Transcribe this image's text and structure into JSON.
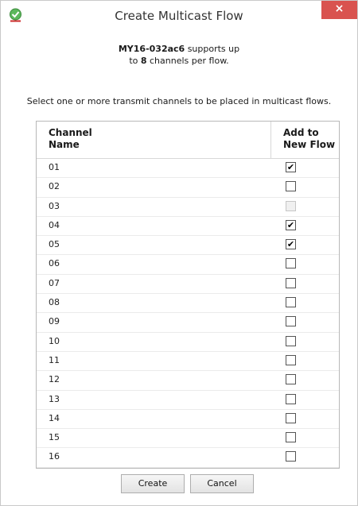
{
  "window": {
    "title": "Create Multicast Flow",
    "close_label": "×"
  },
  "intro": {
    "device_name": "MY16-032ac6",
    "supports_text": " supports up",
    "line2_prefix": "to ",
    "channel_count": "8",
    "line2_suffix": " channels per flow."
  },
  "instruction": "Select one or more transmit channels to be placed in multicast flows.",
  "table": {
    "header_name_line1": "Channel",
    "header_name_line2": "Name",
    "header_add_line1": "Add to",
    "header_add_line2": "New Flow",
    "rows": [
      {
        "name": "01",
        "checked": true,
        "disabled": false
      },
      {
        "name": "02",
        "checked": false,
        "disabled": false
      },
      {
        "name": "03",
        "checked": false,
        "disabled": true
      },
      {
        "name": "04",
        "checked": true,
        "disabled": false
      },
      {
        "name": "05",
        "checked": true,
        "disabled": false
      },
      {
        "name": "06",
        "checked": false,
        "disabled": false
      },
      {
        "name": "07",
        "checked": false,
        "disabled": false
      },
      {
        "name": "08",
        "checked": false,
        "disabled": false
      },
      {
        "name": "09",
        "checked": false,
        "disabled": false
      },
      {
        "name": "10",
        "checked": false,
        "disabled": false
      },
      {
        "name": "11",
        "checked": false,
        "disabled": false
      },
      {
        "name": "12",
        "checked": false,
        "disabled": false
      },
      {
        "name": "13",
        "checked": false,
        "disabled": false
      },
      {
        "name": "14",
        "checked": false,
        "disabled": false
      },
      {
        "name": "15",
        "checked": false,
        "disabled": false
      },
      {
        "name": "16",
        "checked": false,
        "disabled": false
      }
    ]
  },
  "buttons": {
    "create_label": "Create",
    "cancel_label": "Cancel"
  },
  "icons": {
    "app": "green-check-icon",
    "close": "close-icon",
    "check": "✔"
  },
  "colors": {
    "close_bg": "#d9534f",
    "app_icon_green": "#5cb85c"
  }
}
